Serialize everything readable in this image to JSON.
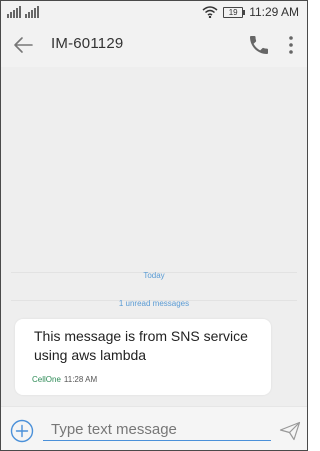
{
  "status_bar": {
    "battery_level": "19",
    "time": "11:29 AM",
    "icons": [
      "signal-icon",
      "wifi-icon",
      "battery-icon"
    ]
  },
  "toolbar": {
    "title": "IM-601129",
    "icons": [
      "back-arrow-icon",
      "phone-icon",
      "more-vertical-icon"
    ]
  },
  "conversation": {
    "date_divider": "Today",
    "unread_divider": "1 unread messages",
    "messages": [
      {
        "text": "This message is from SNS service using aws lambda",
        "sim_label": "CellOne",
        "time": "11:28 AM"
      }
    ]
  },
  "compose": {
    "placeholder": "Type text message",
    "value": "",
    "icons": [
      "add-icon",
      "send-icon"
    ]
  },
  "colors": {
    "accent": "#4a90d9",
    "divider_text": "#5a9bd4",
    "sim_label": "#2e8b57"
  }
}
